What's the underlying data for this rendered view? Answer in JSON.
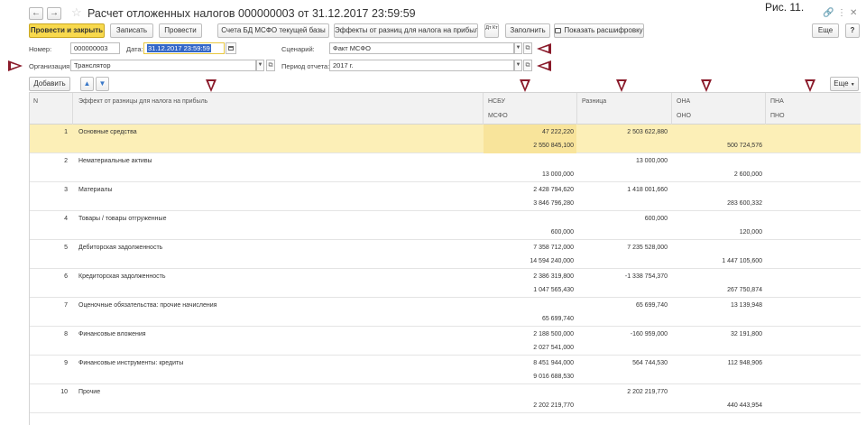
{
  "window": {
    "title": "Расчет отложенных налогов 000000003 от 31.12.2017 23:59:59",
    "figure_label": "Рис. 11.",
    "back_glyph": "←",
    "forward_glyph": "→",
    "favorite_glyph": "☆",
    "link_glyph": "🔗",
    "more_glyph": "⋮",
    "close_glyph": "✕"
  },
  "toolbar": {
    "post_and_close": "Провести и закрыть",
    "save": "Записать",
    "post": "Провести",
    "accounts": "Счета БД МСФО текущей базы",
    "effects": "Эффекты от разниц для налога на прибыль",
    "dt_kt": "Дт Кт",
    "fill": "Заполнить",
    "show_breakdown": "Показать расшифровку",
    "more": "Еще",
    "help": "?"
  },
  "form": {
    "number_label": "Номер:",
    "number_value": "000000003",
    "date_label": "Дата:",
    "date_value": "31.12.2017 23:59:59",
    "scenario_label": "Сценарий:",
    "scenario_value": "Факт МСФО",
    "org_label": "Организация:",
    "org_value": "Транслятор",
    "period_label": "Период отчета:",
    "period_value": "2017 г."
  },
  "table_toolbar": {
    "add": "Добавить",
    "more": "Еще"
  },
  "columns": {
    "n": "N",
    "effect": "Эффект от разницы для налога на прибыль",
    "nsbu": "НСБУ",
    "msfo": "МСФО",
    "diff": "Разница",
    "ona_top": "ОНА",
    "ona_bottom": "ОНО",
    "pna_top": "ПНА",
    "pna_bottom": "ПНО"
  },
  "rows": [
    {
      "n": "1",
      "name": "Основные средства",
      "nsbu": "47 222,220",
      "msfo": "2 550 845,100",
      "diff": "2 503 622,880",
      "ona": "",
      "ono": "500 724,576"
    },
    {
      "n": "2",
      "name": "Нематериальные активы",
      "nsbu": "",
      "msfo": "13 000,000",
      "diff": "13 000,000",
      "ona": "",
      "ono": "2 600,000"
    },
    {
      "n": "3",
      "name": "Материалы",
      "nsbu": "2 428 794,620",
      "msfo": "3 846 796,280",
      "diff": "1 418 001,660",
      "ona": "",
      "ono": "283 600,332"
    },
    {
      "n": "4",
      "name": "Товары / товары отгруженные",
      "nsbu": "",
      "msfo": "600,000",
      "diff": "600,000",
      "ona": "",
      "ono": "120,000"
    },
    {
      "n": "5",
      "name": "Дебиторская задолженность",
      "nsbu": "7 358 712,000",
      "msfo": "14 594 240,000",
      "diff": "7 235 528,000",
      "ona": "",
      "ono": "1 447 105,600"
    },
    {
      "n": "6",
      "name": "Кредиторская задолженность",
      "nsbu": "2 386 319,800",
      "msfo": "1 047 565,430",
      "diff": "-1 338 754,370",
      "ona": "",
      "ono": "267 750,874"
    },
    {
      "n": "7",
      "name": "Оценочные обязательства: прочие начисления",
      "nsbu": "",
      "msfo": "65 699,740",
      "diff": "65 699,740",
      "ona": "13 139,948",
      "ono": ""
    },
    {
      "n": "8",
      "name": "Финансовые вложения",
      "nsbu": "2 188 500,000",
      "msfo": "2 027 541,000",
      "diff": "-160 959,000",
      "ona": "32 191,800",
      "ono": ""
    },
    {
      "n": "9",
      "name": "Финансовые инструменты: кредиты",
      "nsbu": "8 451 944,000",
      "msfo": "9 016 688,530",
      "diff": "564 744,530",
      "ona": "112 948,906",
      "ono": ""
    },
    {
      "n": "10",
      "name": "Прочие",
      "nsbu": "",
      "msfo": "2 202 219,770",
      "diff": "2 202 219,770",
      "ona": "",
      "ono": "440 443,954"
    }
  ]
}
